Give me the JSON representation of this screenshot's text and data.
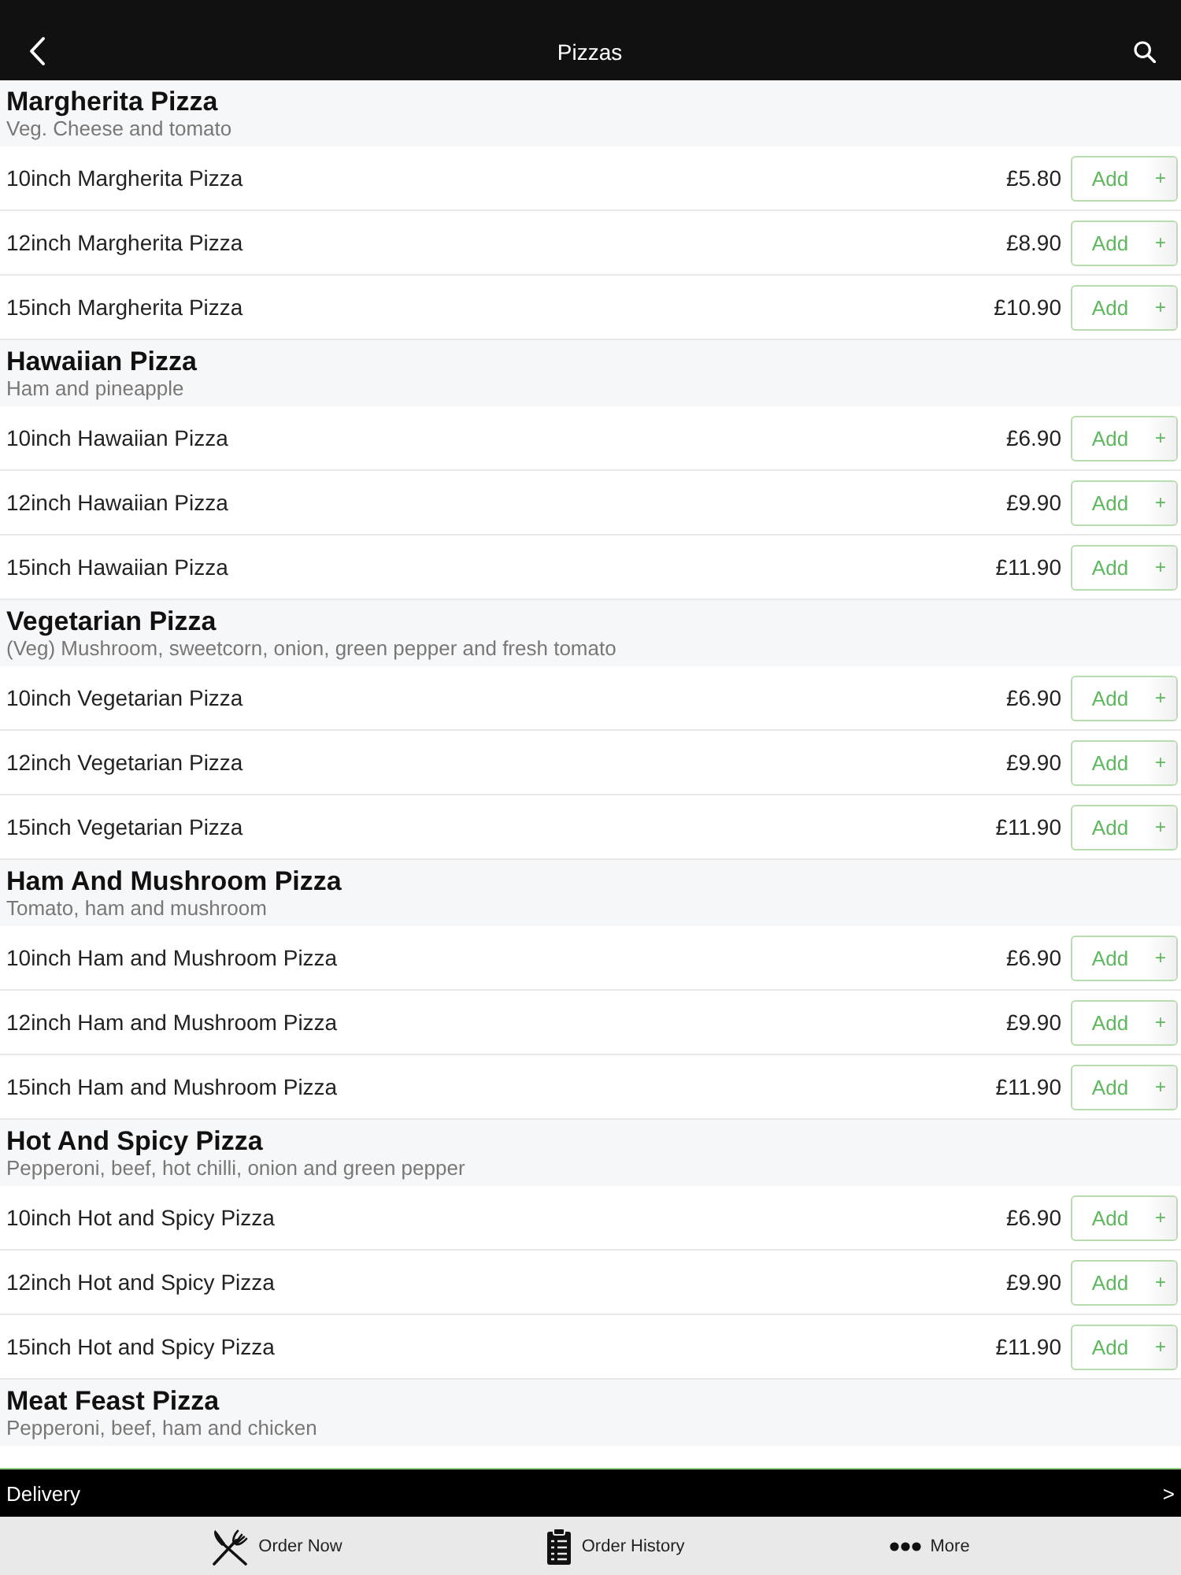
{
  "nav_bar": {
    "title": "Pizzas"
  },
  "sections": [
    {
      "title": "Margherita Pizza",
      "description": "Veg. Cheese and tomato",
      "items": [
        {
          "name": "10inch Margherita Pizza",
          "price": "£5.80",
          "button": "Add",
          "plus": "+"
        },
        {
          "name": "12inch Margherita Pizza",
          "price": "£8.90",
          "button": "Add",
          "plus": "+"
        },
        {
          "name": "15inch Margherita Pizza",
          "price": "£10.90",
          "button": "Add",
          "plus": "+"
        }
      ]
    },
    {
      "title": "Hawaiian Pizza",
      "description": "Ham and pineapple",
      "items": [
        {
          "name": "10inch Hawaiian Pizza",
          "price": "£6.90",
          "button": "Add",
          "plus": "+"
        },
        {
          "name": "12inch Hawaiian Pizza",
          "price": "£9.90",
          "button": "Add",
          "plus": "+"
        },
        {
          "name": "15inch Hawaiian Pizza",
          "price": "£11.90",
          "button": "Add",
          "plus": "+"
        }
      ]
    },
    {
      "title": "Vegetarian Pizza",
      "description": "(Veg) Mushroom, sweetcorn, onion, green pepper and fresh tomato",
      "items": [
        {
          "name": "10inch Vegetarian Pizza",
          "price": "£6.90",
          "button": "Add",
          "plus": "+"
        },
        {
          "name": "12inch Vegetarian Pizza",
          "price": "£9.90",
          "button": "Add",
          "plus": "+"
        },
        {
          "name": "15inch Vegetarian Pizza",
          "price": "£11.90",
          "button": "Add",
          "plus": "+"
        }
      ]
    },
    {
      "title": "Ham And Mushroom Pizza",
      "description": "Tomato, ham and mushroom",
      "items": [
        {
          "name": "10inch Ham and Mushroom Pizza",
          "price": "£6.90",
          "button": "Add",
          "plus": "+"
        },
        {
          "name": "12inch Ham and Mushroom Pizza",
          "price": "£9.90",
          "button": "Add",
          "plus": "+"
        },
        {
          "name": "15inch Ham and Mushroom Pizza",
          "price": "£11.90",
          "button": "Add",
          "plus": "+"
        }
      ]
    },
    {
      "title": "Hot And Spicy Pizza",
      "description": "Pepperoni, beef, hot chilli, onion and green pepper",
      "items": [
        {
          "name": "10inch Hot and Spicy Pizza",
          "price": "£6.90",
          "button": "Add",
          "plus": "+"
        },
        {
          "name": "12inch Hot and Spicy Pizza",
          "price": "£9.90",
          "button": "Add",
          "plus": "+"
        },
        {
          "name": "15inch Hot and Spicy Pizza",
          "price": "£11.90",
          "button": "Add",
          "plus": "+"
        }
      ]
    },
    {
      "title": "Meat Feast Pizza",
      "description": "Pepperoni, beef, ham and chicken"
    }
  ],
  "delivery_bar": {
    "label": "Delivery",
    "arrow": ">"
  },
  "tab_bar": [
    {
      "kind": "cutlery",
      "label": "Order Now"
    },
    {
      "kind": "clipboard",
      "label": "Order History"
    },
    {
      "kind": "dots",
      "label": "More"
    }
  ]
}
